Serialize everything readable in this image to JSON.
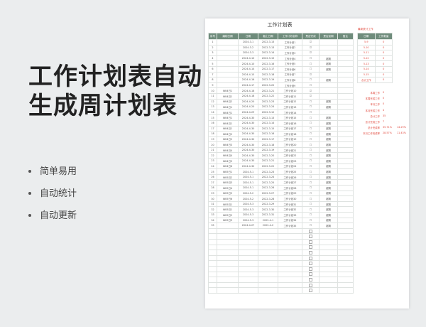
{
  "headline": [
    "工作计划表自动",
    "生成周计划表"
  ],
  "features": [
    "简单易用",
    "自动统计",
    "自动更新"
  ],
  "sheet": {
    "title": "工作计划表",
    "headers": [
      "序号",
      "编制日期",
      "日期",
      "截止日期",
      "工作计划名称",
      "是否完成",
      "是否延期",
      "备注"
    ],
    "rows": [
      {
        "no": "1",
        "code": "",
        "date": "2024-3-1",
        "due": "2022-3-13",
        "name": "工作计划1",
        "done": "☑",
        "delay": ""
      },
      {
        "no": "2",
        "code": "",
        "date": "2024-3-2",
        "due": "2022-3-13",
        "name": "工作计划2",
        "done": "☑",
        "delay": ""
      },
      {
        "no": "3",
        "code": "",
        "date": "2024-3-3",
        "due": "2022-3-14",
        "name": "工作计划3",
        "done": "☑",
        "delay": ""
      },
      {
        "no": "4",
        "code": "",
        "date": "2024-4-10",
        "due": "2022-3-15",
        "name": "工作计划4",
        "done": "☐",
        "delay": "超期"
      },
      {
        "no": "5",
        "code": "",
        "date": "2024-4-10",
        "due": "2022-3-16",
        "name": "工作计划5",
        "done": "☐",
        "delay": "超期"
      },
      {
        "no": "6",
        "code": "",
        "date": "2024-4-14",
        "due": "2022-3-17",
        "name": "工作计划6",
        "done": "☐",
        "delay": "超期"
      },
      {
        "no": "7",
        "code": "",
        "date": "2024-4-15",
        "due": "2022-3-18",
        "name": "工作计划7",
        "done": "☑",
        "delay": ""
      },
      {
        "no": "8",
        "code": "",
        "date": "2024-4-16",
        "due": "2022-3-19",
        "name": "工作计划8",
        "done": "☐",
        "delay": "超期"
      },
      {
        "no": "9",
        "code": "",
        "date": "2024-4-17",
        "due": "2022-3-20",
        "name": "工作计划9",
        "done": "☐",
        "delay": ""
      },
      {
        "no": "10",
        "code": "WK4日1",
        "date": "2024-4-18",
        "due": "2022-3-21",
        "name": "工作计划10",
        "done": "☑",
        "delay": ""
      },
      {
        "no": "11",
        "code": "WK4日1",
        "date": "2024-4-18",
        "due": "2022-3-22",
        "name": "工作计划11",
        "done": "☑",
        "delay": ""
      },
      {
        "no": "12",
        "code": "WK4日2",
        "date": "2024-4-20",
        "due": "2022-3-23",
        "name": "工作计划12",
        "done": "☐",
        "delay": "超期"
      },
      {
        "no": "13",
        "code": "WK4日1",
        "date": "2024-4-20",
        "due": "2022-3-24",
        "name": "工作计划13",
        "done": "☐",
        "delay": "超期"
      },
      {
        "no": "14",
        "code": "WK4日1",
        "date": "2024-4-29",
        "due": "2022-3-12",
        "name": "工作计划14",
        "done": "☐",
        "delay": ""
      },
      {
        "no": "15",
        "code": "WK4日1",
        "date": "2024-4-30",
        "due": "2022-3-13",
        "name": "工作计划15",
        "done": "☐",
        "delay": "超期"
      },
      {
        "no": "16",
        "code": "WK4日1",
        "date": "2024-4-30",
        "due": "2022-3-14",
        "name": "工作计划16",
        "done": "☐",
        "delay": "超期"
      },
      {
        "no": "17",
        "code": "WK4日1",
        "date": "2024-4-30",
        "due": "2022-3-15",
        "name": "工作计划17",
        "done": "☐",
        "delay": "超期"
      },
      {
        "no": "18",
        "code": "WK4日2",
        "date": "2024-4-30",
        "due": "2022-3-16",
        "name": "工作计划18",
        "done": "☐",
        "delay": "超期"
      },
      {
        "no": "19",
        "code": "WK4日2",
        "date": "2024-4-30",
        "due": "2022-3-17",
        "name": "工作计划19",
        "done": "☐",
        "delay": "超期"
      },
      {
        "no": "20",
        "code": "WK4日3",
        "date": "2024-4-30",
        "due": "2022-3-18",
        "name": "工作计划20",
        "done": "☐",
        "delay": "超期"
      },
      {
        "no": "21",
        "code": "WK4日4",
        "date": "2024-4-30",
        "due": "2022-3-19",
        "name": "工作计划21",
        "done": "☐",
        "delay": "超期"
      },
      {
        "no": "22",
        "code": "WK4日4",
        "date": "2024-4-30",
        "due": "2022-3-20",
        "name": "工作计划22",
        "done": "☐",
        "delay": "超期"
      },
      {
        "no": "23",
        "code": "WK4日5",
        "date": "2024-4-30",
        "due": "2022-3-21",
        "name": "工作计划23",
        "done": "☐",
        "delay": "超期"
      },
      {
        "no": "24",
        "code": "WK4日6",
        "date": "2024-4-30",
        "due": "2022-3-22",
        "name": "工作计划24",
        "done": "☐",
        "delay": "超期"
      },
      {
        "no": "25",
        "code": "WK5日1",
        "date": "2024-5-1",
        "due": "2022-3-23",
        "name": "工作计划25",
        "done": "☐",
        "delay": "超期"
      },
      {
        "no": "26",
        "code": "WK5日2",
        "date": "2024-5-1",
        "due": "2022-3-24",
        "name": "工作计划26",
        "done": "☐",
        "delay": "超期"
      },
      {
        "no": "27",
        "code": "WK5日3",
        "date": "2024-5-1",
        "due": "2022-3-25",
        "name": "工作计划27",
        "done": "☐",
        "delay": "超期"
      },
      {
        "no": "28",
        "code": "WK5日4",
        "date": "2024-5-1",
        "due": "2022-3-26",
        "name": "工作计划28",
        "done": "☐",
        "delay": "超期"
      },
      {
        "no": "29",
        "code": "WK5日5",
        "date": "2024-5-2",
        "due": "2022-3-27",
        "name": "工作计划29",
        "done": "☐",
        "delay": "超期"
      },
      {
        "no": "30",
        "code": "WK5日6",
        "date": "2024-5-2",
        "due": "2022-3-28",
        "name": "工作计划30",
        "done": "☐",
        "delay": "超期"
      },
      {
        "no": "31",
        "code": "WK5日1",
        "date": "2024-5-3",
        "due": "2022-3-29",
        "name": "工作计划31",
        "done": "☐",
        "delay": "超期"
      },
      {
        "no": "32",
        "code": "WK5日1",
        "date": "2024-5-3",
        "due": "2022-3-30",
        "name": "工作计划32",
        "done": "☐",
        "delay": "超期"
      },
      {
        "no": "33",
        "code": "WK5日2",
        "date": "2024-5-3",
        "due": "2022-3-31",
        "name": "工作计划33",
        "done": "☐",
        "delay": "超期"
      },
      {
        "no": "34",
        "code": "WK5日3",
        "date": "2024-5-3",
        "due": "2022-4-1",
        "name": "工作计划34",
        "done": "☐",
        "delay": "超期"
      },
      {
        "no": "35",
        "code": "",
        "date": "2024-4-27",
        "due": "2022-4-2",
        "name": "工作计划35",
        "done": "☐",
        "delay": "超期"
      }
    ],
    "empty_rows": 12
  },
  "week_panel": {
    "caption": "最新统计工作",
    "headers": [
      "日期",
      "工作数量"
    ],
    "rows": [
      {
        "d": "5-9",
        "n": "0"
      },
      {
        "d": "5-10",
        "n": "0"
      },
      {
        "d": "5-11",
        "n": "0"
      },
      {
        "d": "5-12",
        "n": "0"
      },
      {
        "d": "5-13",
        "n": "0"
      },
      {
        "d": "5-14",
        "n": "0"
      },
      {
        "d": "5-15",
        "n": "0"
      },
      {
        "d": "合计工作",
        "n": "0"
      }
    ]
  },
  "stats": [
    {
      "label": "本周工作",
      "v1": "0",
      "v2": ""
    },
    {
      "label": "本周完成工作",
      "v1": "0",
      "v2": ""
    },
    {
      "label": "本月工作",
      "v1": "0",
      "v2": ""
    },
    {
      "label": "本月完成工作",
      "v1": "4",
      "v2": ""
    },
    {
      "label": "总计工作",
      "v1": "35",
      "v2": ""
    },
    {
      "label": "总计完成工作",
      "v1": "7",
      "v2": ""
    },
    {
      "label": "总计完成率",
      "v1": "35.71%",
      "v2": "14.29%"
    },
    {
      "label": "本月工作完成率",
      "v1": "28.57%",
      "v2": "11.43%"
    }
  ],
  "colors": {
    "header_bg": "#6f8c7c",
    "accent_red": "#e0463a",
    "background": "#ebedee"
  }
}
